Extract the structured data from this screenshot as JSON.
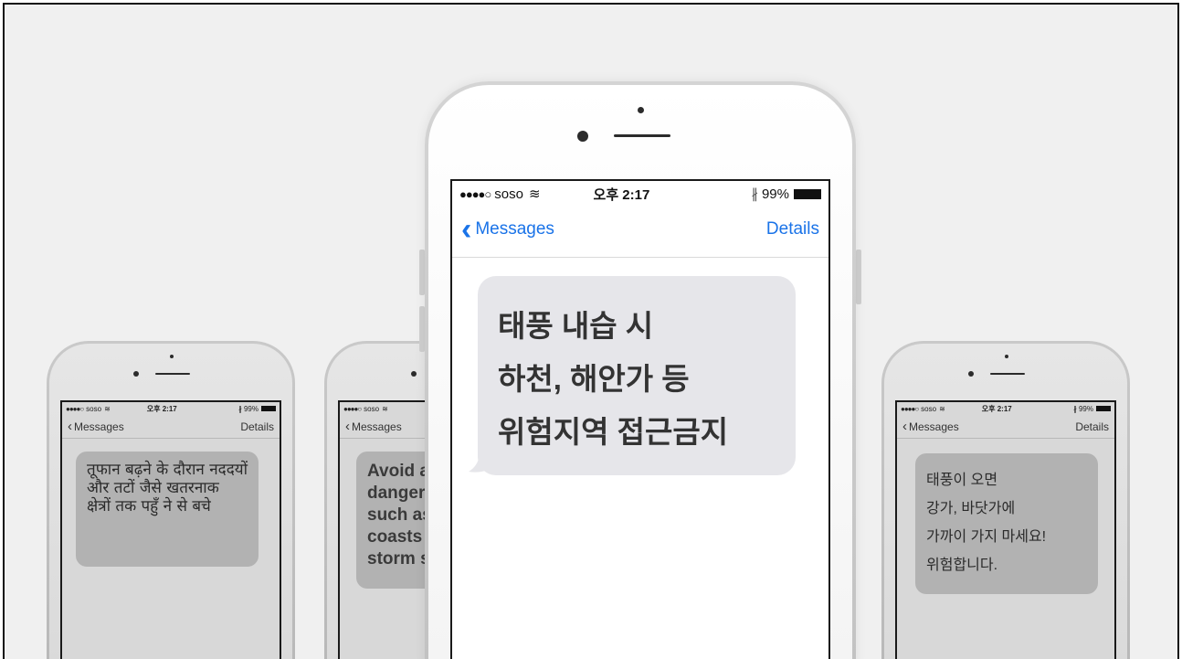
{
  "status": {
    "carrier": "soso",
    "time": "오후 2:17",
    "battery": "99%"
  },
  "nav": {
    "back_label": "Messages",
    "details_label": "Details"
  },
  "phones": {
    "left": {
      "message": "तूफान बढ़ने के दौरान नददयों और तटों जैसे खतरनाक क्षेत्रों तक पहुँ ने से बचे"
    },
    "center_left": {
      "message_lines": [
        "Avoid a",
        "danger",
        "such as",
        "coasts",
        "storm s"
      ]
    },
    "center": {
      "message_lines": [
        "태풍 내습 시",
        "하천, 해안가 등",
        "위험지역 접근금지"
      ]
    },
    "right": {
      "message_lines": [
        "태풍이 오면",
        "강가, 바닷가에",
        "가까이 가지 마세요!",
        "위험합니다."
      ]
    }
  },
  "colors": {
    "ios_blue": "#1a73e8",
    "bubble_gray": "#e6e6ea",
    "bubble_dim": "#b2b2b2"
  }
}
